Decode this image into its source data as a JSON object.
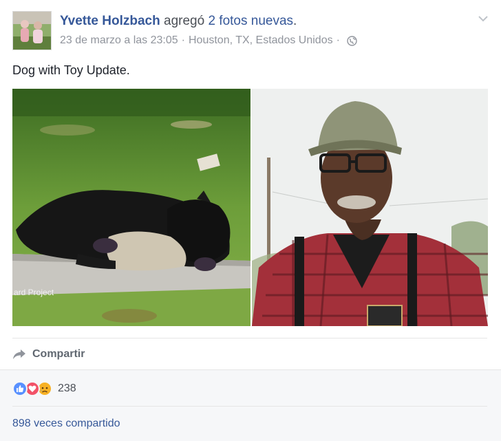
{
  "post": {
    "author": "Yvette Holzbach",
    "action": " agregó ",
    "photos_link": "2 fotos nuevas",
    "period": ".",
    "timestamp": "23 de marzo a las 23:05",
    "separator": "·",
    "location": "Houston, TX, Estados Unidos",
    "text": "Dog with Toy Update.",
    "photo_watermark": "ard Project"
  },
  "actions": {
    "share_label": "Compartir"
  },
  "footer": {
    "reaction_count": "238",
    "shares_text": "898 veces compartido"
  },
  "icons": {
    "privacy": "globe-icon",
    "menu": "chevron-down-icon",
    "share": "share-arrow-icon",
    "reactions": [
      "like-icon",
      "love-icon",
      "sad-icon"
    ]
  },
  "colors": {
    "link": "#365899",
    "meta": "#90949c",
    "like": "#5890ff",
    "love": "#f25268",
    "sad": "#f7b125"
  }
}
